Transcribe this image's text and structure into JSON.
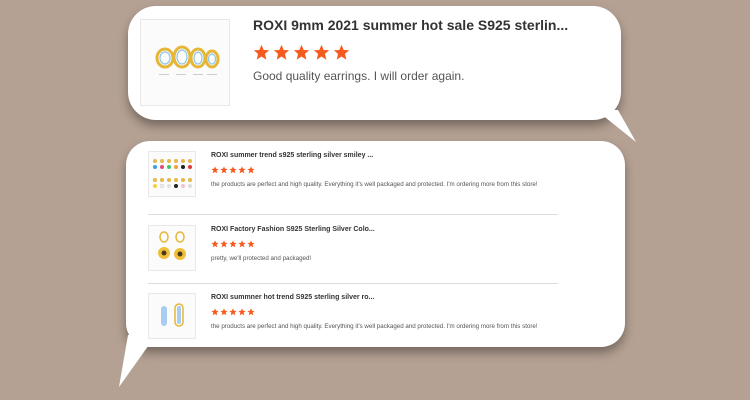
{
  "featured_review": {
    "product_title": "ROXI 9mm 2021 summer hot sale S925 sterlin...",
    "rating": 5,
    "review_text": "Good quality earrings. I will order again."
  },
  "reviews": [
    {
      "product_title": "ROXI summer trend s925 sterling silver smiley ...",
      "rating": 5,
      "review_text": "the products are perfect and high quality. Everything it's well packaged and protected. I'm ordering more from this store!"
    },
    {
      "product_title": "ROXI Factory Fashion S925 Sterling Silver Colo...",
      "rating": 5,
      "review_text": "pretty, we'll protected and packaged!"
    },
    {
      "product_title": "ROXI summner hot trend S925 sterling silver ro...",
      "rating": 5,
      "review_text": "the products are perfect and high quality. Everything it's well packaged and protected. I'm ordering more from this store!"
    }
  ],
  "colors": {
    "background": "#b5a193",
    "star": "#f55a1e",
    "bubble": "#ffffff"
  },
  "icons": [
    "star-icon",
    "speech-bubble-tail"
  ]
}
